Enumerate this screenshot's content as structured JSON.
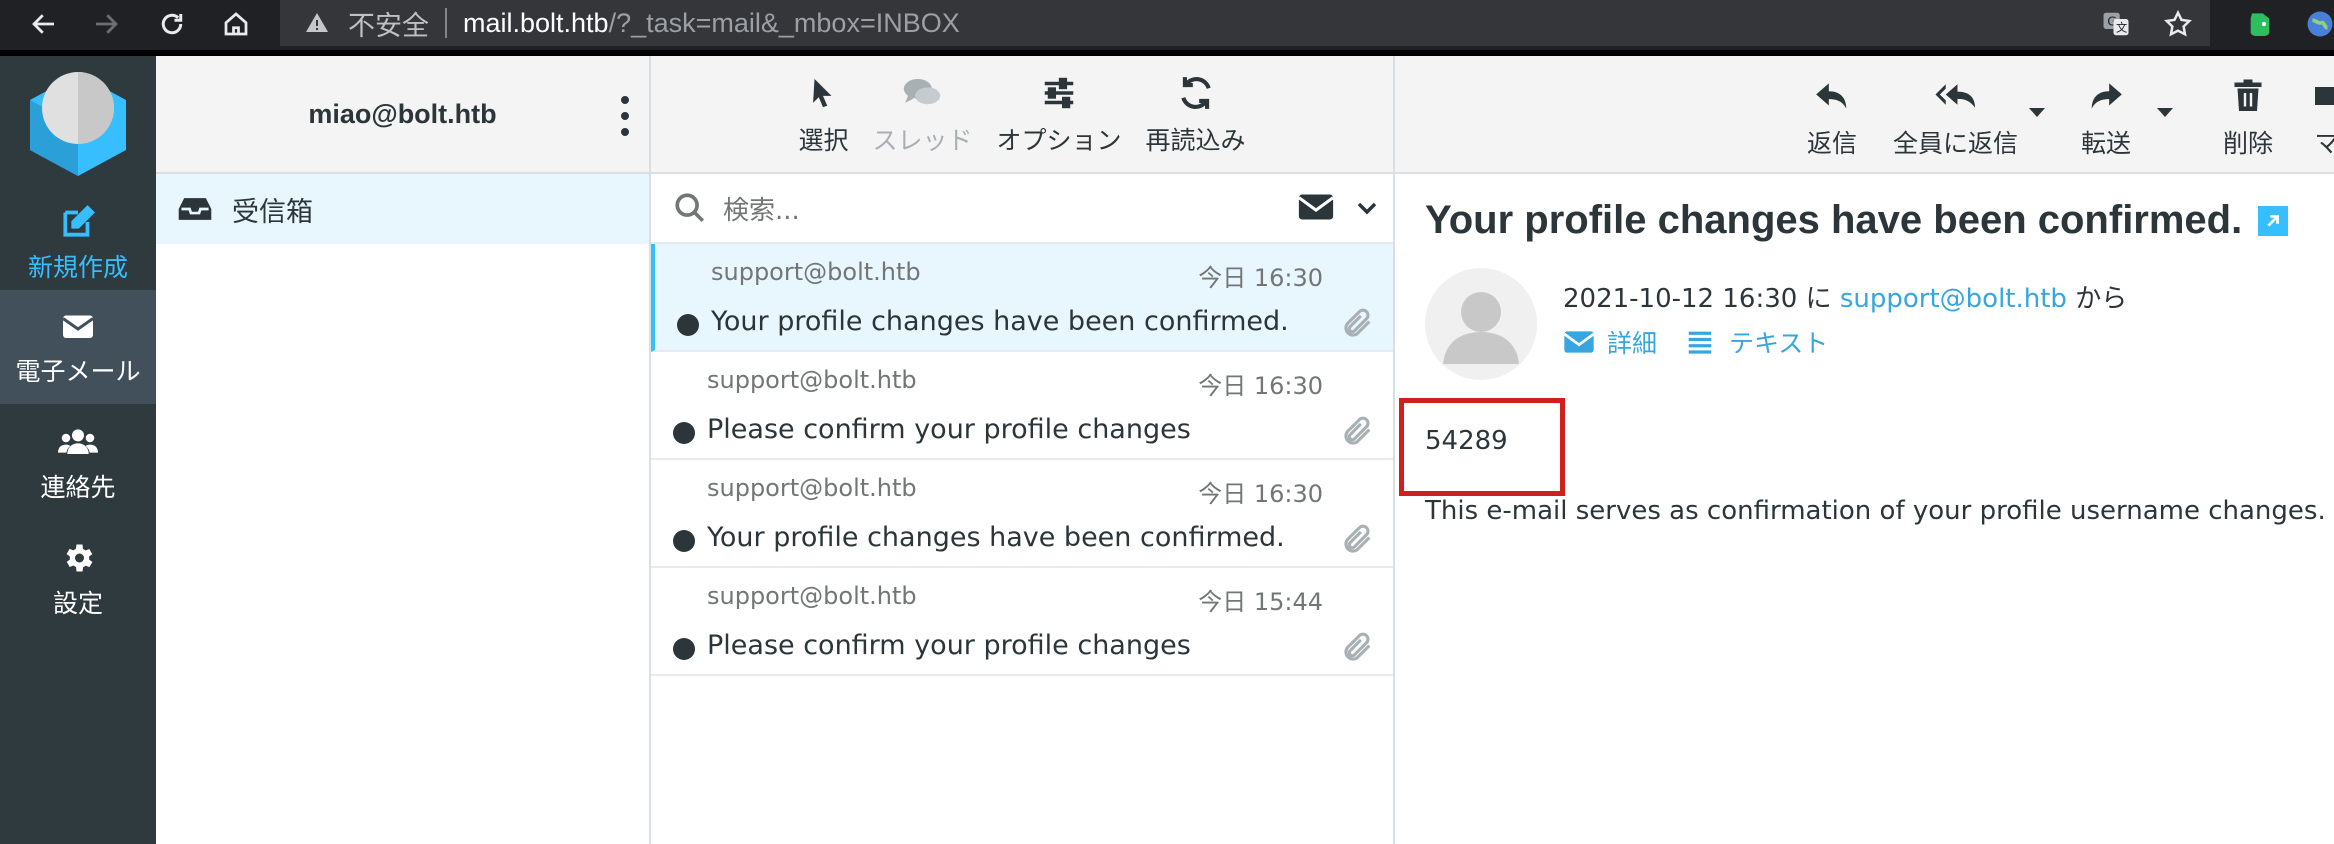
{
  "browser": {
    "security_label": "不安全",
    "url_host": "mail.bolt.htb",
    "url_path": "/?_task=mail&_mbox=INBOX"
  },
  "appnav": {
    "compose": "新規作成",
    "mail": "電子メール",
    "contacts": "連絡先",
    "settings": "設定"
  },
  "folders": {
    "account": "miao@bolt.htb",
    "inbox": "受信箱"
  },
  "list_toolbar": {
    "select": "選択",
    "threads": "スレッド",
    "options": "オプション",
    "refresh": "再読込み"
  },
  "search": {
    "placeholder": "検索..."
  },
  "messages": [
    {
      "from": "support@bolt.htb",
      "date": "今日 16:30",
      "subject": "Your profile changes have been confirmed."
    },
    {
      "from": "support@bolt.htb",
      "date": "今日 16:30",
      "subject": "Please confirm your profile changes"
    },
    {
      "from": "support@bolt.htb",
      "date": "今日 16:30",
      "subject": "Your profile changes have been confirmed."
    },
    {
      "from": "support@bolt.htb",
      "date": "今日 15:44",
      "subject": "Please confirm your profile changes"
    }
  ],
  "reader_toolbar": {
    "reply": "返信",
    "reply_all": "全員に返信",
    "forward": "転送",
    "delete": "削除",
    "mark_partial": "マ"
  },
  "reader": {
    "subject": "Your profile changes have been confirmed.",
    "date": "2021-10-12 16:30",
    "ni": "に",
    "sender": "support@bolt.htb",
    "kara": "から",
    "details": "詳細",
    "text": "テキスト",
    "code": "54289",
    "body": "This e-mail serves as confirmation of your profile username changes."
  },
  "colors": {
    "accent": "#37beff",
    "sidebar": "#2f3a3f",
    "highlight_box": "#d0201e"
  }
}
